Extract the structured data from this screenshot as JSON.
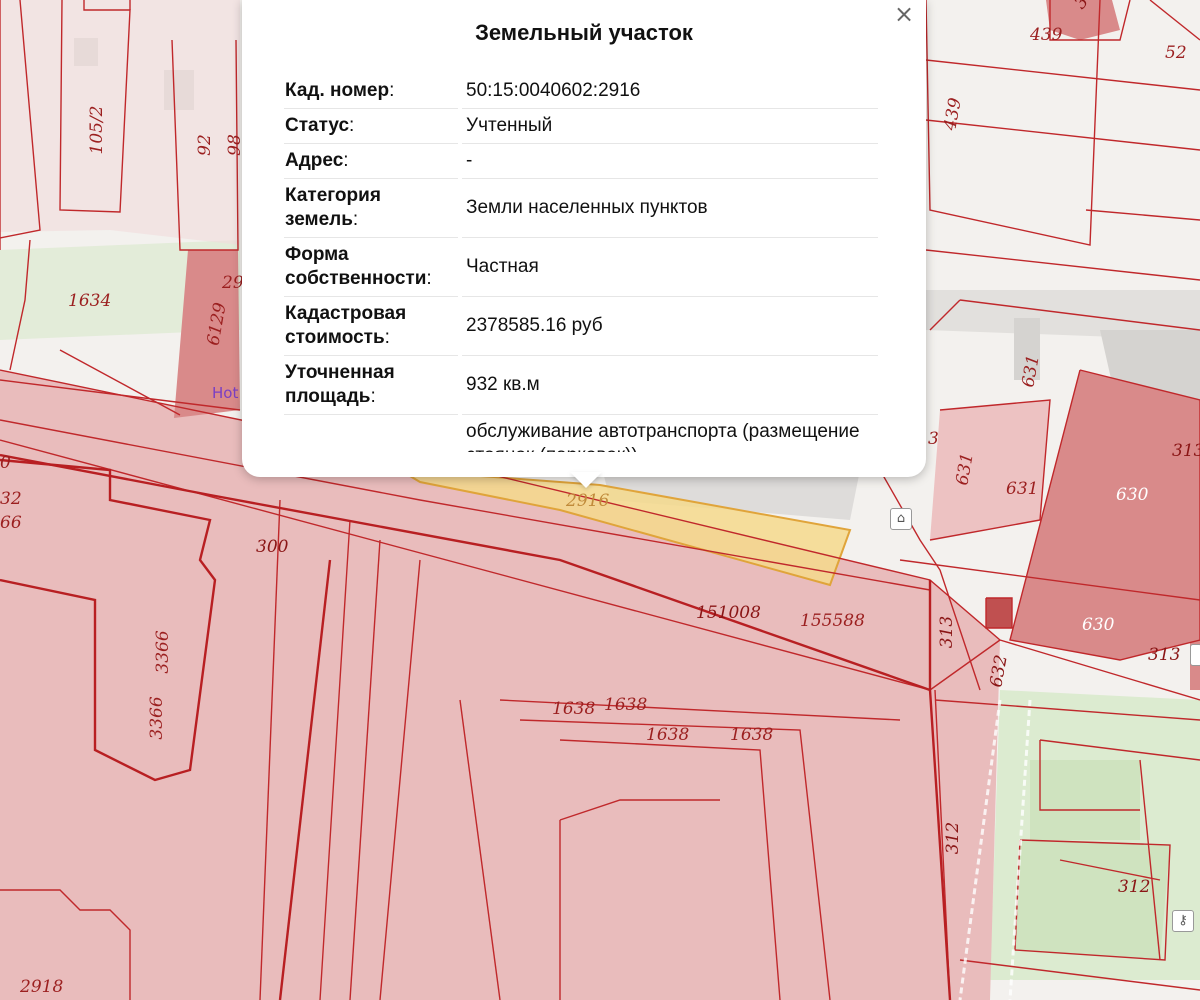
{
  "popup": {
    "title": "Земельный участок",
    "close_label": "×",
    "rows": [
      {
        "key": "Кад. номер",
        "value": "50:15:0040602:2916"
      },
      {
        "key": "Статус",
        "value": "Учтенный"
      },
      {
        "key": "Адрес",
        "value": "-"
      },
      {
        "key": "Категория земель",
        "value": "Земли населенных пунктов"
      },
      {
        "key": "Форма собственности",
        "value": "Частная"
      },
      {
        "key": "Кадастровая стоимость",
        "value": "2378585.16 руб"
      },
      {
        "key": "Уточненная площадь",
        "value": "932 кв.м"
      },
      {
        "key": "",
        "value": "обслуживание автотранспорта (размещение стоянок (парковок))"
      }
    ]
  },
  "map": {
    "colors": {
      "parcel_fill": "#e9bcbc",
      "parcel_fill_dark": "#d98a8a",
      "parcel_stroke": "#c0282b",
      "selected_fill": "#f4d98c",
      "selected_stroke": "#e0a43a",
      "green": "#dcedcf",
      "building": "#d5d3d0",
      "road": "#f7f6f4"
    },
    "labels": {
      "l_105_2": "105/2",
      "l_92": "92",
      "l_98": "98",
      "l_29": "29",
      "l_6129": "6129",
      "l_1634": "1634",
      "l_439a": "439",
      "l_439b": "439",
      "l_52": "52",
      "l_36": "36",
      "l_631a": "631",
      "l_631b": "631",
      "l_631c": "631",
      "l_630a": "630",
      "l_630b": "630",
      "l_313a": "313",
      "l_313b": "313",
      "l_313c": "313",
      "l_3": "3",
      "l_2916": "2916",
      "l_300": "300",
      "l_151008": "151008",
      "l_155588": "155588",
      "l_632": "632",
      "l_1638a": "1638",
      "l_1638b": "1638",
      "l_1638c": "1638",
      "l_1638d": "1638",
      "l_3366a": "3366",
      "l_3366b": "3366",
      "l_312a": "312",
      "l_312b": "312",
      "l_2918": "2918",
      "l_32": "32",
      "l_66": "66",
      "l_0": "0"
    },
    "poi_text": "Hot"
  }
}
